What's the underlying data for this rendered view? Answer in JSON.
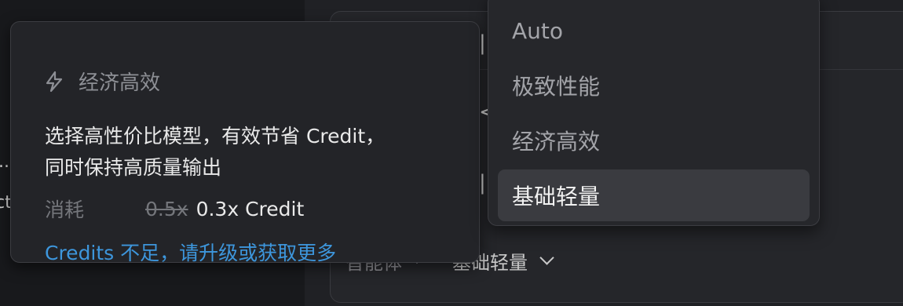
{
  "left_panel": {
    "fragment_1": "..",
    "fragment_2": "ct"
  },
  "composer": {
    "agent_mode_label": "智能体",
    "model_label": "基础轻量"
  },
  "tooltip": {
    "title": "经济高效",
    "description_line1": "选择高性价比模型，有效节省 Credit，",
    "description_line2": "同时保持高质量输出",
    "cost_label": "消耗",
    "cost_old": "0.5x",
    "cost_new": "0.3x Credit",
    "upgrade_link": "Credits 不足，请升级或获取更多"
  },
  "dropdown": {
    "items": [
      {
        "label": "Auto",
        "selected": false
      },
      {
        "label": "极致性能",
        "selected": false
      },
      {
        "label": "经济高效",
        "selected": false
      },
      {
        "label": "基础轻量",
        "selected": true
      }
    ]
  },
  "colors": {
    "link": "#3d96dc",
    "selected_bg": "#3a3b40",
    "panel_bg": "#232428"
  }
}
